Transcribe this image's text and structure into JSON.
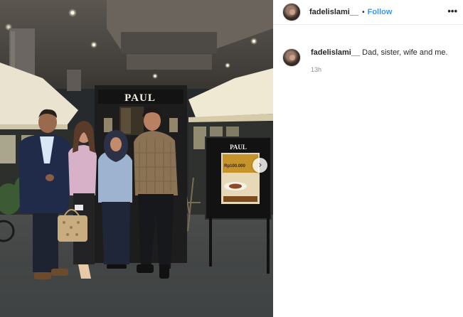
{
  "post": {
    "username": "fadelislami__",
    "separator": "•",
    "follow_label": "Follow",
    "more_icon": "more-options-icon",
    "more_glyph": "•••",
    "next_glyph": "›",
    "photo_store_sign": "PAUL",
    "photo_menu_sign": "PAUL",
    "photo_menu_price": "Rp100.000"
  },
  "caption": {
    "username": "fadelislami__",
    "text": " Dad, sister, wife and me.",
    "time": "13h"
  }
}
